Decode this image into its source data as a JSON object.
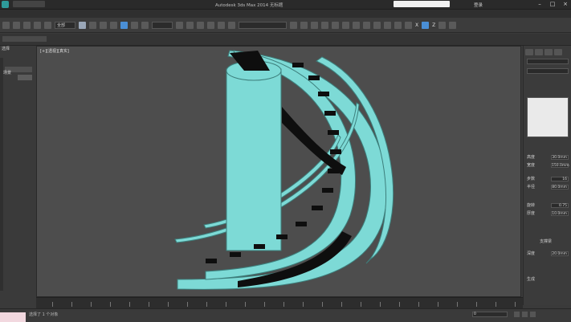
{
  "window": {
    "title": "Autodesk 3ds Max 2014    无标题",
    "search_placeholder": "",
    "login_label": "登录"
  },
  "toolbar": {
    "selection_filter": "全部",
    "axis_x": "X",
    "axis_z": "Z",
    "axis_y": "Y"
  },
  "left_panel": {
    "tab_label": "选择",
    "scene_label": "场景"
  },
  "viewport": {
    "label": "[+][透视][真实]",
    "object_color": "#7ddad6"
  },
  "right_panel": {
    "rows": [
      {
        "label": "高度",
        "value": "30.0mm"
      },
      {
        "label": "宽度",
        "value": "150.0mm"
      },
      {
        "label": "步数",
        "value": "16"
      },
      {
        "label": "半径",
        "value": "80.0mm"
      },
      {
        "label": "旋转",
        "value": "0.75"
      },
      {
        "label": "厚度",
        "value": "10.0mm"
      },
      {
        "label": "深度",
        "value": "20.0mm"
      }
    ],
    "section_label": "支撑梁",
    "checkbox_label": "生成"
  },
  "status": {
    "text": "选择了 1 个对象",
    "field_value": "0"
  }
}
